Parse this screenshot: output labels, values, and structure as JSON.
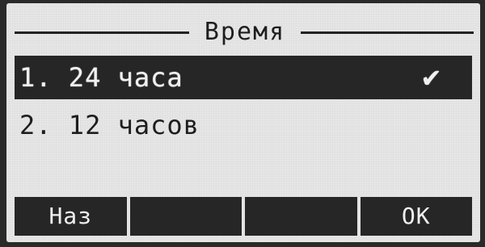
{
  "header": {
    "title": "Время"
  },
  "menu": {
    "items": [
      {
        "label": "1. 24 часа",
        "checkmark": "✔",
        "selected": true
      },
      {
        "label": "2. 12 часов",
        "selected": false
      }
    ]
  },
  "softkeys": [
    {
      "label": "Наз"
    },
    {
      "label": ""
    },
    {
      "label": ""
    },
    {
      "label": "OK"
    }
  ],
  "icons": {
    "check": "check-icon"
  },
  "colors": {
    "screen_background": "#e6e6e6",
    "highlight": "#262626",
    "text": "#1e1e1e",
    "inverse_text": "#f0f0f0"
  }
}
